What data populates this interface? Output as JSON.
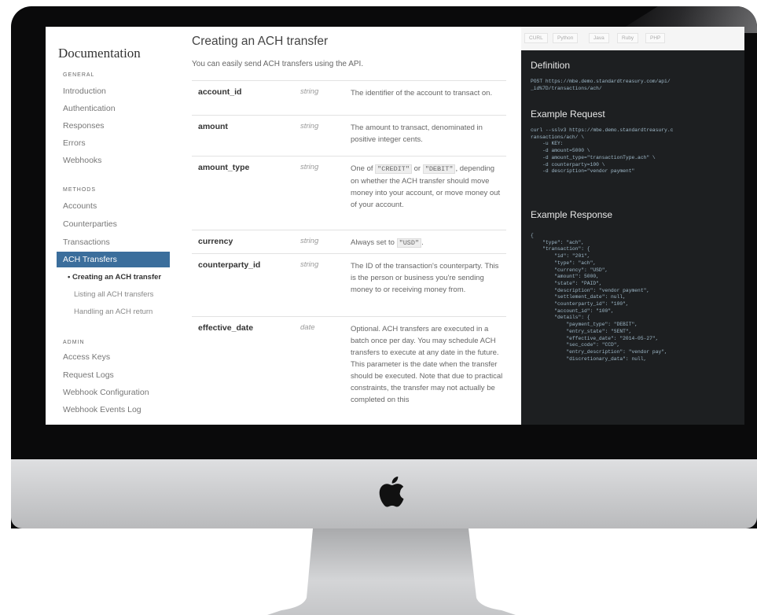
{
  "sidebar": {
    "title": "Documentation",
    "section_general": "GENERAL",
    "general_items": [
      "Introduction",
      "Authentication",
      "Responses",
      "Errors",
      "Webhooks"
    ],
    "section_methods": "METHODS",
    "methods_items": [
      "Accounts",
      "Counterparties",
      "Transactions"
    ],
    "active_item": "ACH Transfers",
    "sub_items": [
      "• Creating an ACH transfer",
      "Listing all ACH transfers",
      "Handling an ACH return"
    ],
    "section_admin": "ADMIN",
    "admin_items": [
      "Access Keys",
      "Request Logs",
      "Webhook Configuration",
      "Webhook Events Log"
    ]
  },
  "main": {
    "title": "Creating an ACH transfer",
    "intro": "You can easily send ACH transfers using the API.",
    "params": [
      {
        "name": "account_id",
        "type": "string",
        "desc": "The identifier of the account to transact on."
      },
      {
        "name": "amount",
        "type": "string",
        "desc": "The amount to transact, denominated in positive integer cents."
      },
      {
        "name": "amount_type",
        "type": "string",
        "desc_pre": "One of ",
        "code1": "\"CREDIT\"",
        "desc_mid": " or ",
        "code2": "\"DEBIT\"",
        "desc_post": ", depending on whether the ACH transfer should move money into your account, or move money out of your account."
      },
      {
        "name": "currency",
        "type": "string",
        "desc_pre": "Always set to ",
        "code1": "\"USD\"",
        "desc_post": "."
      },
      {
        "name": "counterparty_id",
        "type": "string",
        "desc": "The ID of the transaction's counterparty. This is the person or business you're sending money to or receiving money from."
      },
      {
        "name": "effective_date",
        "type": "date",
        "desc": "Optional. ACH transfers are executed in a batch once per day. You may schedule ACH transfers to execute at any date in the future. This parameter is the date when the transfer should be executed. Note that due to practical constraints, the transfer may not actually be completed on this"
      }
    ]
  },
  "code_panel": {
    "tabs": [
      "CURL",
      "Python",
      "Java",
      "Ruby",
      "PHP"
    ],
    "definition_heading": "Definition",
    "definition_code": "POST https://mbe.demo.standardtreasury.com/api/\n_id%7D/transactions/ach/",
    "request_heading": "Example Request",
    "request_code": "curl --sslv3 https://mbe.demo.standardtreasury.c\nransactions/ach/ \\\n    -u KEY:\n    -d amount=5000 \\\n    -d amount_type=\"transactionType.ach\" \\\n    -d counterparty=100 \\\n    -d description=\"vendor payment\"",
    "response_heading": "Example Response",
    "response_code": "{\n    \"type\": \"ach\",\n    \"transaction\": {\n        \"id\": \"201\",\n        \"type\": \"ach\",\n        \"currency\": \"USD\",\n        \"amount\": 5000,\n        \"state\": \"PAID\",\n        \"description\": \"vendor payment\",\n        \"settlement_date\": null,\n        \"counterparty_id\": \"100\",\n        \"account_id\": \"100\",\n        \"details\": {\n            \"payment_type\": \"DEBIT\",\n            \"entry_state\": \"SENT\",\n            \"effective_date\": \"2014-05-27\",\n            \"sec_code\": \"CCD\",\n            \"entry_description\": \"vendor pay\",\n            \"discretionary_data\": null,"
  },
  "colors": {
    "active_nav": "#3b6e9c",
    "code_background": "#1d1f21",
    "bezel": "#0a0a0b"
  }
}
